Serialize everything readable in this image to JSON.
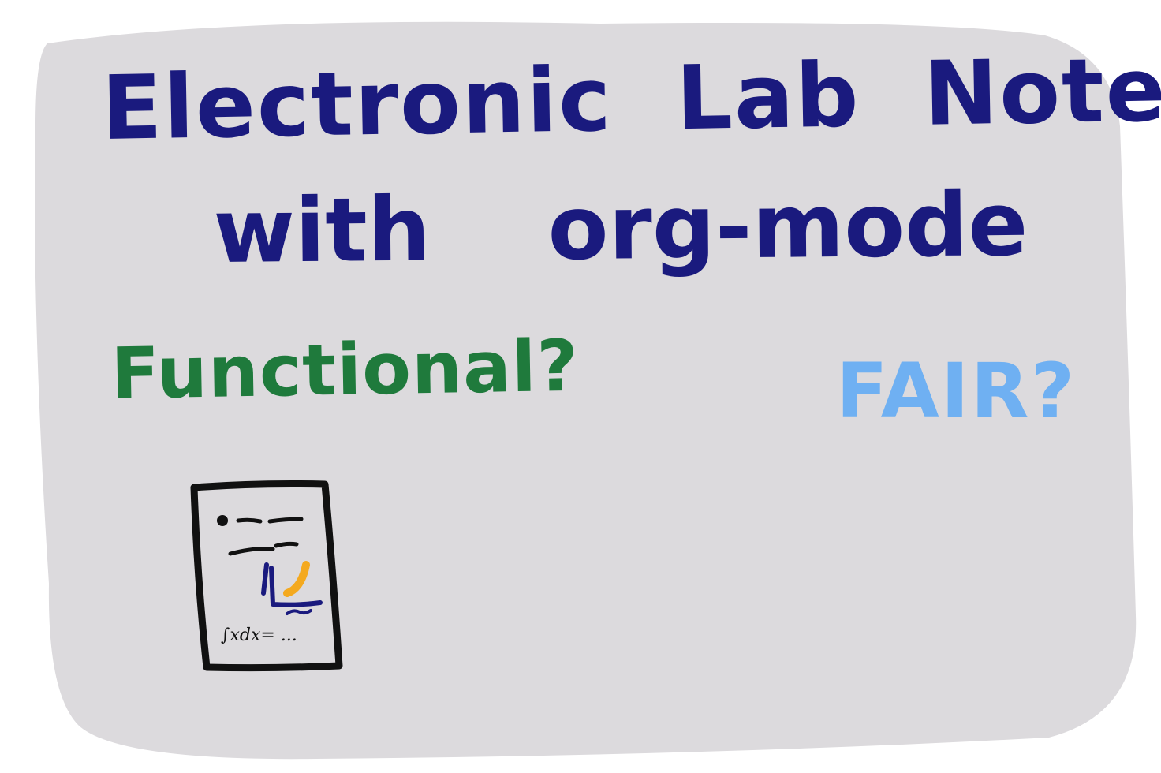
{
  "title": {
    "line1": "Electronic Lab Notebook",
    "line2": "with org-mode",
    "color": "#1a1a7e"
  },
  "questions": {
    "functional": "Functional?",
    "functional_color": "#1f7a3c",
    "fair": "FAIR?",
    "fair_color": "#6fb0f2"
  },
  "document_sketch": {
    "formula": "∫xdx= ...",
    "icon": "document-icon",
    "accent_color": "#f4a91f"
  },
  "board": {
    "background_color": "#dcdadd"
  }
}
